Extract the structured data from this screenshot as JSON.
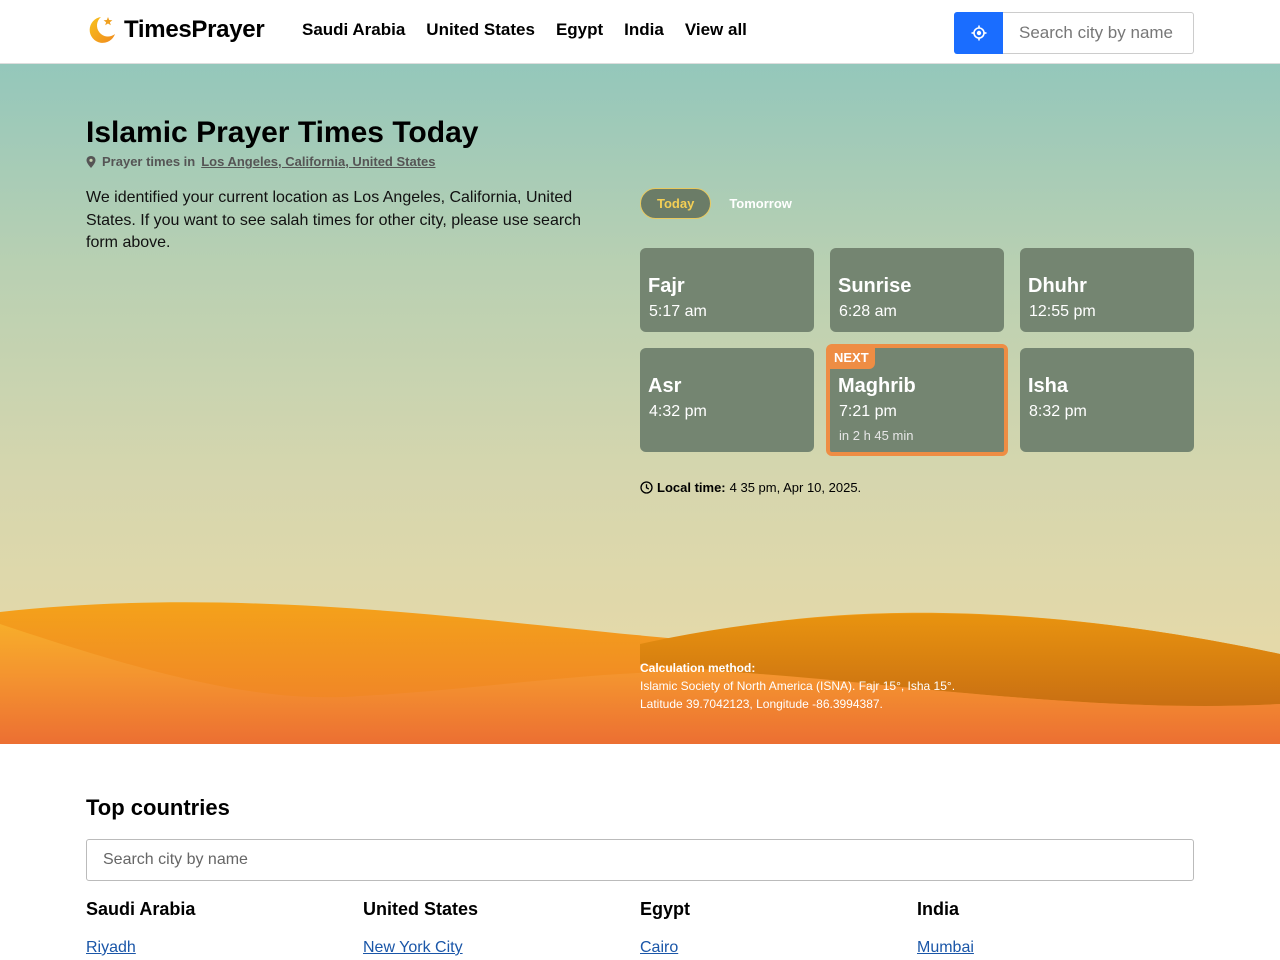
{
  "brand": {
    "name": "TimesPrayer"
  },
  "nav": [
    "Saudi Arabia",
    "United States",
    "Egypt",
    "India",
    "View all"
  ],
  "header_search": {
    "placeholder": "Search city by name"
  },
  "hero": {
    "title": "Islamic Prayer Times Today",
    "location_prefix": "Prayer times in",
    "location_link": "Los Angeles, California, United States",
    "intro": "We identified your current location as Los Angeles, California, United States. If you want to see salah times for other city, please use search form above."
  },
  "day_tabs": {
    "today": "Today",
    "tomorrow": "Tomorrow"
  },
  "prayers": [
    {
      "name": "Fajr",
      "time": "5:17 am"
    },
    {
      "name": "Sunrise",
      "time": "6:28 am"
    },
    {
      "name": "Dhuhr",
      "time": "12:55 pm"
    },
    {
      "name": "Asr",
      "time": "4:32 pm"
    },
    {
      "name": "Maghrib",
      "time": "7:21 pm",
      "badge": "NEXT",
      "countdown": "in 2 h 45 min"
    },
    {
      "name": "Isha",
      "time": "8:32 pm"
    }
  ],
  "local_time": {
    "label": "Local time:",
    "value": "4 35 pm, Apr 10, 2025."
  },
  "calculation": {
    "label": "Calculation method:",
    "method": "Islamic Society of North America (ISNA). Fajr 15°, Isha 15°.",
    "coords": "Latitude 39.7042123, Longitude -86.3994387."
  },
  "top_countries": {
    "title": "Top countries",
    "search_placeholder": "Search city by name",
    "countries": [
      {
        "name": "Saudi Arabia",
        "city": "Riyadh"
      },
      {
        "name": "United States",
        "city": "New York City"
      },
      {
        "name": "Egypt",
        "city": "Cairo"
      },
      {
        "name": "India",
        "city": "Mumbai"
      }
    ]
  },
  "colors": {
    "accent_blue": "#1a6dff",
    "card_bg": "#748571",
    "next_highlight": "#ee8d44",
    "tab_active_text": "#f4cf55",
    "link": "#1a56a8"
  },
  "icons": {
    "logo": "crescent-star-icon",
    "locate": "crosshair-location-icon",
    "location_pin": "map-pin-icon",
    "clock": "clock-icon"
  }
}
